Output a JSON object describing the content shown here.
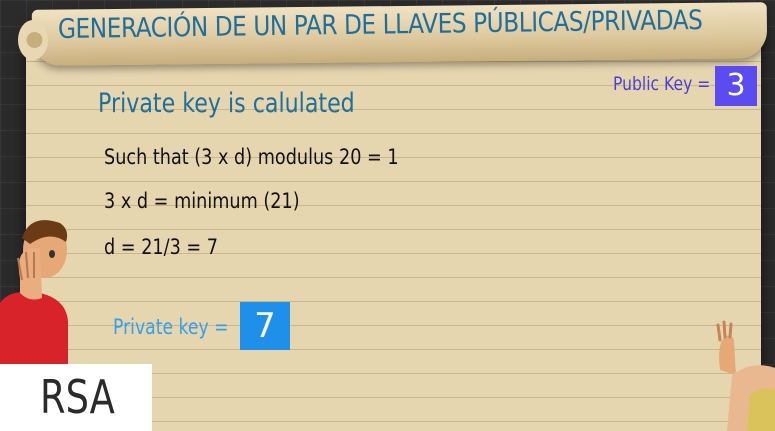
{
  "slide": {
    "heading": "GENERACIÓN DE UN PAR DE LLAVES PÚBLICAS/PRIVADAS",
    "subtitle": "Private key is calulated",
    "lines": [
      "Such that (3 x d) modulus 20 = 1",
      "3 x d = minimum (21)",
      "d = 21/3 = 7"
    ],
    "public_key": {
      "label": "Public Key =",
      "value": "3"
    },
    "private_key": {
      "label": "Private key =",
      "value": "7"
    },
    "logo_text": "RSA"
  },
  "colors": {
    "heading": "#1f6f9a",
    "public_key": "#5a4cf0",
    "private_key": "#1e90ea",
    "paper": "#e6d6b0",
    "background": "#2b2b2b"
  }
}
